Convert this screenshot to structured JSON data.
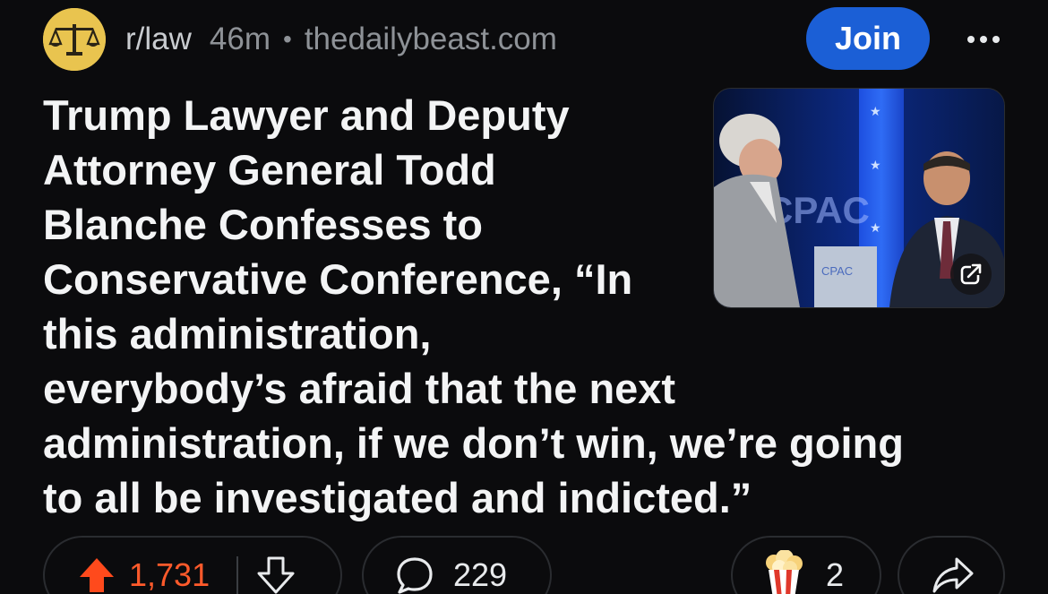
{
  "post": {
    "subreddit": "r/law",
    "time_ago": "46m",
    "separator": "•",
    "domain": "thedailybeast.com",
    "join_label": "Join",
    "title_lines": [
      "Trump Lawyer and Deputy",
      "Attorney General Todd",
      "Blanche Confesses to",
      "Conservative Conference, “In",
      "this administration,",
      "everybody’s afraid that the next",
      "administration, if we don’t win, we’re going",
      "to all be investigated and indicted.”"
    ],
    "thumbnail": {
      "backdrop_text": "CPAC",
      "podium_text": "CPAC"
    }
  },
  "actions": {
    "upvotes": "1,731",
    "comments": "229",
    "awards": "2"
  },
  "colors": {
    "background": "#0b0b0d",
    "join_button": "#1b5fd6",
    "upvote_active": "#ff5a2b",
    "avatar": "#e9c44f"
  },
  "icons": {
    "avatar": "scales-of-justice-icon",
    "more": "more-horizontal-icon",
    "external_link": "external-link-icon",
    "upvote": "upvote-arrow-icon",
    "downvote": "downvote-arrow-icon",
    "comment": "comment-bubble-icon",
    "award": "popcorn-award-icon",
    "share": "share-arrow-icon"
  }
}
